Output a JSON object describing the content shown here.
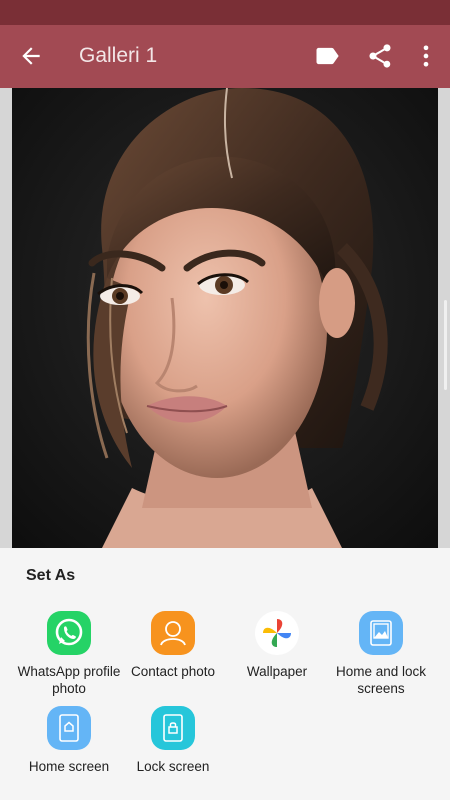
{
  "header": {
    "title": "Galleri 1"
  },
  "icons": {
    "back": "arrow-back-icon",
    "label": "label-icon",
    "share": "share-icon",
    "more": "more-vert-icon"
  },
  "sheet": {
    "title": "Set As",
    "options": [
      {
        "label": "WhatsApp profile photo",
        "icon": "whatsapp-icon",
        "color": "#25d366"
      },
      {
        "label": "Contact photo",
        "icon": "contact-photo-icon",
        "color": "#f7931e"
      },
      {
        "label": "Wallpaper",
        "icon": "google-photos-icon",
        "color": "#ffffff"
      },
      {
        "label": "Home and lock screens",
        "icon": "home-lock-screens-icon",
        "color": "#64b5f6"
      },
      {
        "label": "Home screen",
        "icon": "home-screen-icon",
        "color": "#64b5f6"
      },
      {
        "label": "Lock screen",
        "icon": "lock-screen-icon",
        "color": "#26c6da"
      }
    ]
  },
  "colors": {
    "appbar": "#a24a53",
    "statusbar": "#7a2f36"
  }
}
